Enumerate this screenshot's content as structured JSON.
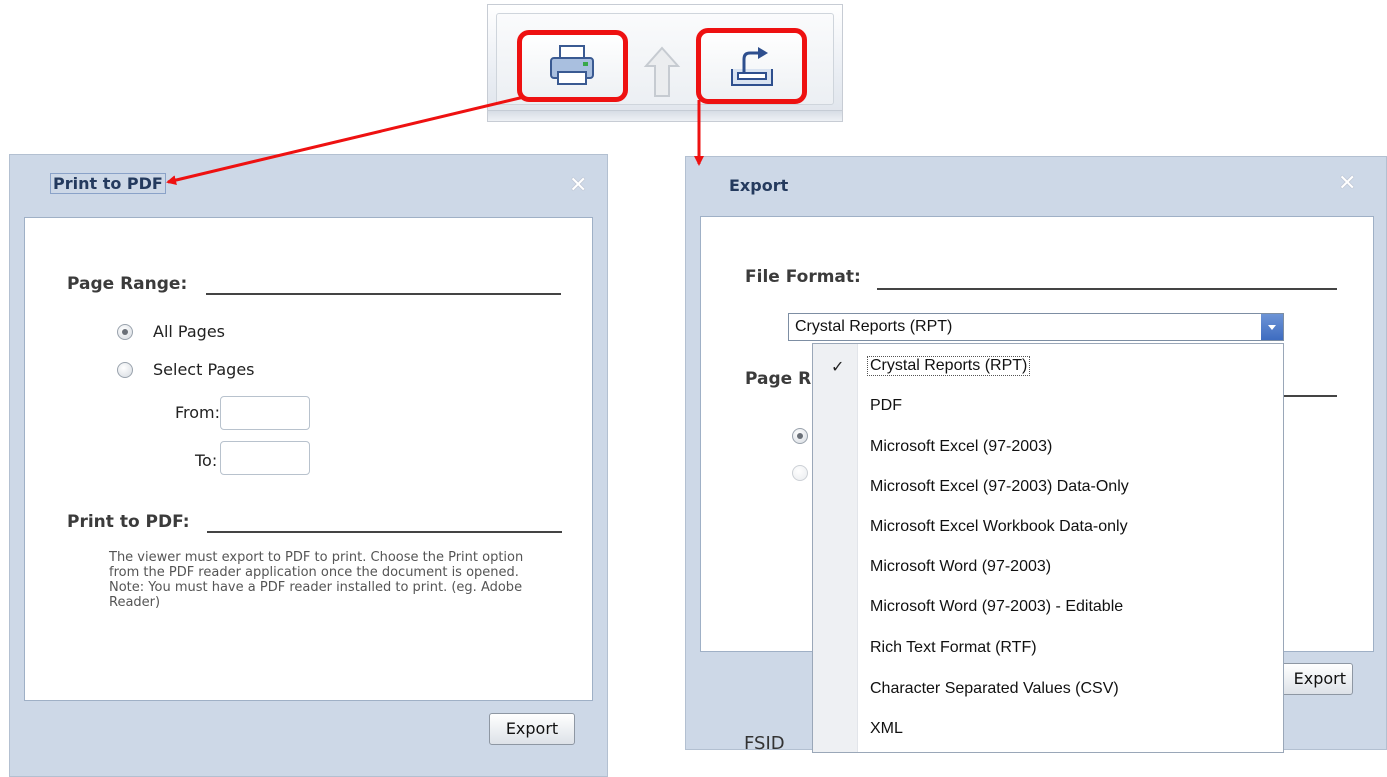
{
  "toolbar": {
    "print_icon": "printer-icon",
    "up_icon": "up-arrow-icon",
    "export_icon": "export-icon"
  },
  "print_dialog": {
    "title": "Print to PDF",
    "close_glyph": "✕",
    "page_range_label": "Page Range:",
    "all_pages_label": "All Pages",
    "select_pages_label": "Select Pages",
    "from_label": "From:",
    "to_label": "To:",
    "from_value": "",
    "to_value": "",
    "print_section_label": "Print to PDF:",
    "note": "The viewer must export to PDF to print. Choose the Print option from the PDF reader application once the document is opened. Note: You must have a PDF reader installed to print. (eg. Adobe Reader)",
    "export_button": "Export"
  },
  "export_dialog": {
    "title": "Export",
    "close_glyph": "✕",
    "file_format_label": "File Format:",
    "selected_format": "Crystal Reports (RPT)",
    "page_range_partial": "Page R",
    "export_button_partial": "Export",
    "behind_text": "FSID",
    "check_glyph": "✓",
    "format_options": [
      "Crystal Reports (RPT)",
      "PDF",
      "Microsoft Excel (97-2003)",
      "Microsoft Excel (97-2003) Data-Only",
      "Microsoft Excel Workbook Data-only",
      "Microsoft Word (97-2003)",
      "Microsoft Word (97-2003) - Editable",
      "Rich Text Format (RTF)",
      "Character Separated Values (CSV)",
      "XML"
    ]
  },
  "colors": {
    "highlight": "#ee1111",
    "dialog_bg": "#cdd8e7",
    "title_text": "#243a5e"
  }
}
